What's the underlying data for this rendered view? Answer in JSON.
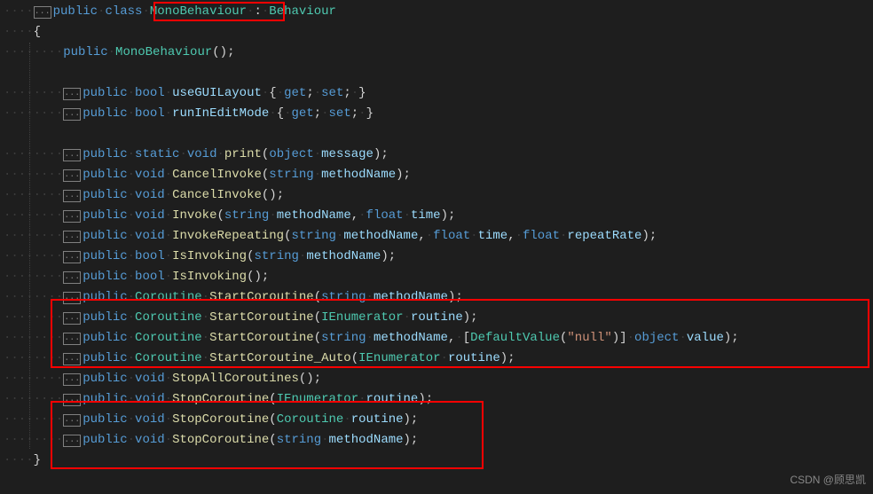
{
  "fold": "...",
  "kw": {
    "public": "public",
    "class": "class",
    "static": "static",
    "void": "void",
    "bool": "bool",
    "object": "object",
    "string": "string",
    "float": "float",
    "get": "get",
    "set": "set"
  },
  "names": {
    "MonoBehaviour": "MonoBehaviour",
    "Behaviour": "Behaviour",
    "Coroutine": "Coroutine",
    "IEnumerator": "IEnumerator",
    "DefaultValue": "DefaultValue"
  },
  "methods": {
    "ctor": "MonoBehaviour",
    "useGUILayout": "useGUILayout",
    "runInEditMode": "runInEditMode",
    "print": "print",
    "CancelInvoke": "CancelInvoke",
    "Invoke": "Invoke",
    "InvokeRepeating": "InvokeRepeating",
    "IsInvoking": "IsInvoking",
    "StartCoroutine": "StartCoroutine",
    "StartCoroutine_Auto": "StartCoroutine_Auto",
    "StopAllCoroutines": "StopAllCoroutines",
    "StopCoroutine": "StopCoroutine"
  },
  "params": {
    "message": "message",
    "methodName": "methodName",
    "time": "time",
    "repeatRate": "repeatRate",
    "routine": "routine",
    "value": "value"
  },
  "str_null": "\"null\"",
  "watermark": "CSDN @顾思凯"
}
